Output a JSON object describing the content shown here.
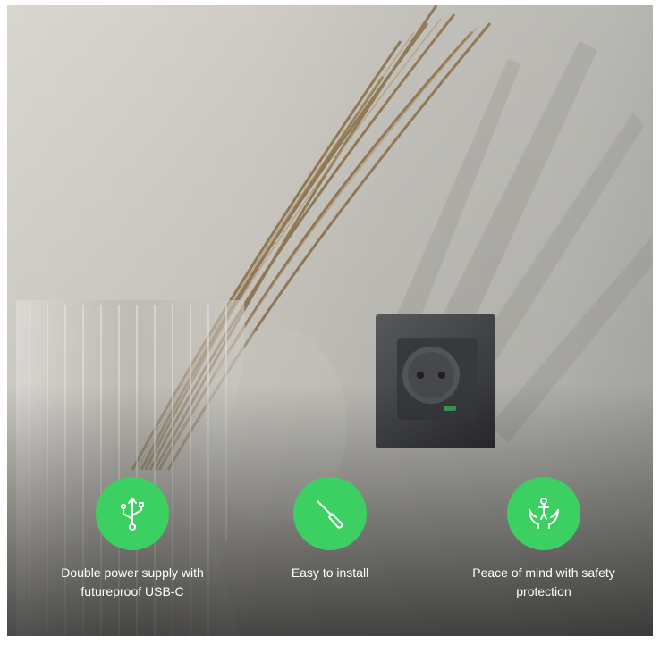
{
  "colors": {
    "accent": "#3ccf61",
    "text": "#ffffff"
  },
  "features": [
    {
      "icon": "usb-icon",
      "label": "Double power supply with futureproof USB-C"
    },
    {
      "icon": "screwdriver-icon",
      "label": "Easy to install"
    },
    {
      "icon": "hands-protect-icon",
      "label": "Peace of mind with safety protection"
    }
  ]
}
